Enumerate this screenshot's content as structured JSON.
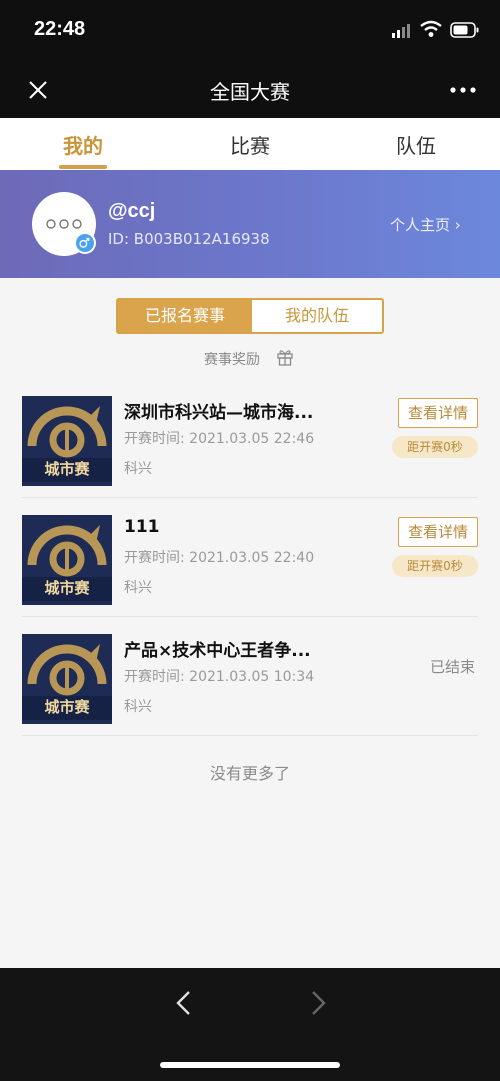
{
  "status": {
    "time": "22:48"
  },
  "nav": {
    "title": "全国大赛"
  },
  "tabs": [
    "我的",
    "比赛",
    "队伍"
  ],
  "profile": {
    "name": "@ccj",
    "id": "ID:  B003B012A16938",
    "homepage": "个人主页 ›"
  },
  "segment": {
    "registered": "已报名赛事",
    "my_team": "我的队伍"
  },
  "reward": {
    "label": "赛事奖励"
  },
  "matches": [
    {
      "badge": "城市赛",
      "title": "深圳市科兴站—城市海...",
      "time": "开赛时间:  2021.03.05 22:46",
      "location": "科兴",
      "button": "查看详情",
      "countdown": "距开赛0秒"
    },
    {
      "badge": "城市赛",
      "title": "111",
      "time": "开赛时间:  2021.03.05 22:40",
      "location": "科兴",
      "button": "查看详情",
      "countdown": "距开赛0秒"
    },
    {
      "badge": "城市赛",
      "title": "产品×技术中心王者争...",
      "time": "开赛时间:  2021.03.05 10:34",
      "location": "科兴",
      "status": "已结束"
    }
  ],
  "footer": {
    "no_more": "没有更多了"
  },
  "colors": {
    "accent": "#d4a04a",
    "profile_gradient_start": "#6d6ab8",
    "profile_gradient_end": "#6c88dc"
  }
}
